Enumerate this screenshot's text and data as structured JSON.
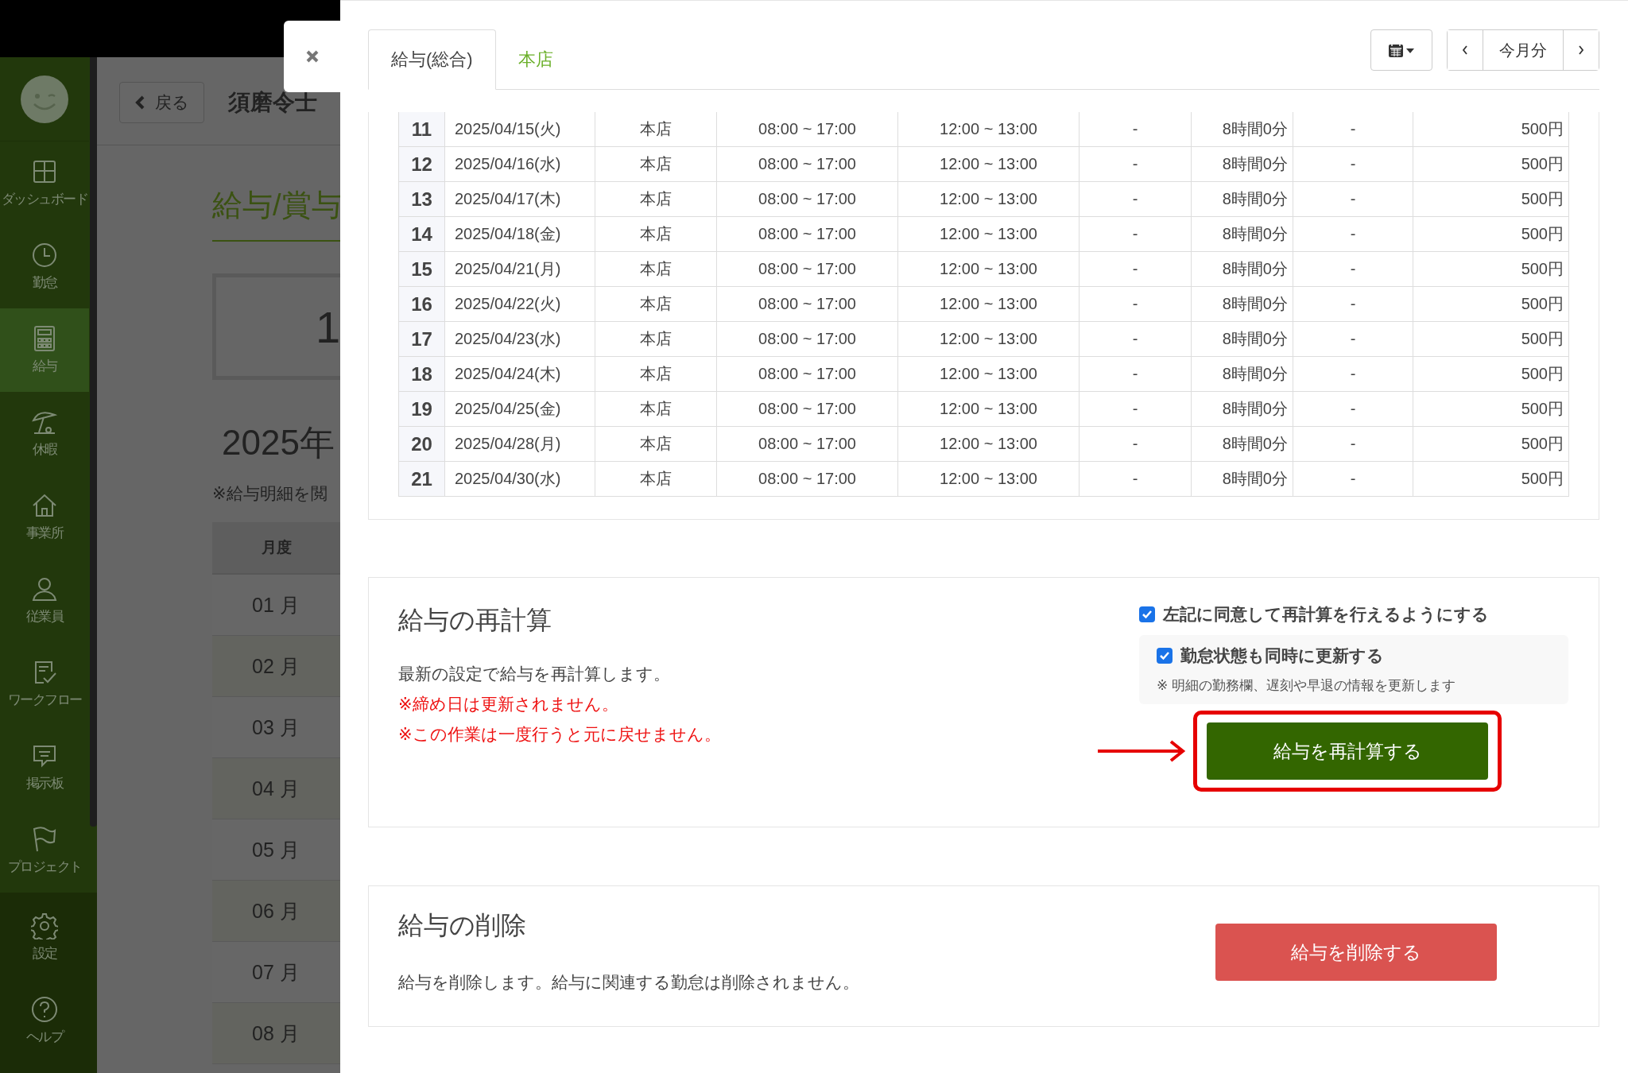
{
  "background": {
    "sidebar": {
      "items": [
        {
          "label": "ダッシュボード",
          "selected": false
        },
        {
          "label": "勤怠",
          "selected": false
        },
        {
          "label": "給与",
          "selected": true
        },
        {
          "label": "休暇",
          "selected": false
        },
        {
          "label": "事業所",
          "selected": false
        },
        {
          "label": "従業員",
          "selected": false
        },
        {
          "label": "ワークフロー",
          "selected": false
        },
        {
          "label": "掲示板",
          "selected": false
        },
        {
          "label": "プロジェクト",
          "selected": false
        }
      ],
      "footer_items": [
        {
          "label": "設定"
        },
        {
          "label": "ヘルプ"
        }
      ]
    },
    "back_button": "戻る",
    "employee_name": "須磨令士",
    "page_title": "給与/賞与",
    "summary_value": "1",
    "year": "2025年",
    "note": "※給与明細を閲",
    "month_table": {
      "column": "月度",
      "rows": [
        "01 月",
        "02 月",
        "03 月",
        "04 月",
        "05 月",
        "06 月",
        "07 月",
        "08 月"
      ]
    }
  },
  "modal": {
    "tabs": [
      {
        "label": "給与(総合)",
        "selected": true
      },
      {
        "label": "本店",
        "selected": false
      }
    ],
    "period_label": "今月分",
    "attendance_table": {
      "rows": [
        {
          "no": "11",
          "cells": [
            "2025/04/15(火)",
            "本店",
            "08:00 ~ 17:00",
            "12:00 ~ 13:00",
            "-",
            "8時間0分",
            "-",
            "500円"
          ]
        },
        {
          "no": "12",
          "cells": [
            "2025/04/16(水)",
            "本店",
            "08:00 ~ 17:00",
            "12:00 ~ 13:00",
            "-",
            "8時間0分",
            "-",
            "500円"
          ]
        },
        {
          "no": "13",
          "cells": [
            "2025/04/17(木)",
            "本店",
            "08:00 ~ 17:00",
            "12:00 ~ 13:00",
            "-",
            "8時間0分",
            "-",
            "500円"
          ]
        },
        {
          "no": "14",
          "cells": [
            "2025/04/18(金)",
            "本店",
            "08:00 ~ 17:00",
            "12:00 ~ 13:00",
            "-",
            "8時間0分",
            "-",
            "500円"
          ]
        },
        {
          "no": "15",
          "cells": [
            "2025/04/21(月)",
            "本店",
            "08:00 ~ 17:00",
            "12:00 ~ 13:00",
            "-",
            "8時間0分",
            "-",
            "500円"
          ]
        },
        {
          "no": "16",
          "cells": [
            "2025/04/22(火)",
            "本店",
            "08:00 ~ 17:00",
            "12:00 ~ 13:00",
            "-",
            "8時間0分",
            "-",
            "500円"
          ]
        },
        {
          "no": "17",
          "cells": [
            "2025/04/23(水)",
            "本店",
            "08:00 ~ 17:00",
            "12:00 ~ 13:00",
            "-",
            "8時間0分",
            "-",
            "500円"
          ]
        },
        {
          "no": "18",
          "cells": [
            "2025/04/24(木)",
            "本店",
            "08:00 ~ 17:00",
            "12:00 ~ 13:00",
            "-",
            "8時間0分",
            "-",
            "500円"
          ]
        },
        {
          "no": "19",
          "cells": [
            "2025/04/25(金)",
            "本店",
            "08:00 ~ 17:00",
            "12:00 ~ 13:00",
            "-",
            "8時間0分",
            "-",
            "500円"
          ]
        },
        {
          "no": "20",
          "cells": [
            "2025/04/28(月)",
            "本店",
            "08:00 ~ 17:00",
            "12:00 ~ 13:00",
            "-",
            "8時間0分",
            "-",
            "500円"
          ]
        },
        {
          "no": "21",
          "cells": [
            "2025/04/30(水)",
            "本店",
            "08:00 ~ 17:00",
            "12:00 ~ 13:00",
            "-",
            "8時間0分",
            "-",
            "500円"
          ]
        }
      ]
    },
    "recalculate": {
      "title": "給与の再計算",
      "lines": [
        {
          "text": "最新の設定で給与を再計算します。",
          "kind": "info"
        },
        {
          "text": "※締め日は更新されません。",
          "kind": "warning"
        },
        {
          "text": "※この作業は一度行うと元に戻せません。",
          "kind": "warning"
        }
      ],
      "agree": {
        "label": "左記に同意して再計算を行えるようにする",
        "checked": true
      },
      "update_attendance": {
        "label": "勤怠状態も同時に更新する",
        "checked": true,
        "note": "※ 明細の勤務欄、遅刻や早退の情報を更新します"
      },
      "button": "給与を再計算する"
    },
    "delete": {
      "title": "給与の削除",
      "description": "給与を削除します。給与に関連する勤怠は削除されません。",
      "button": "給与を削除する"
    }
  }
}
